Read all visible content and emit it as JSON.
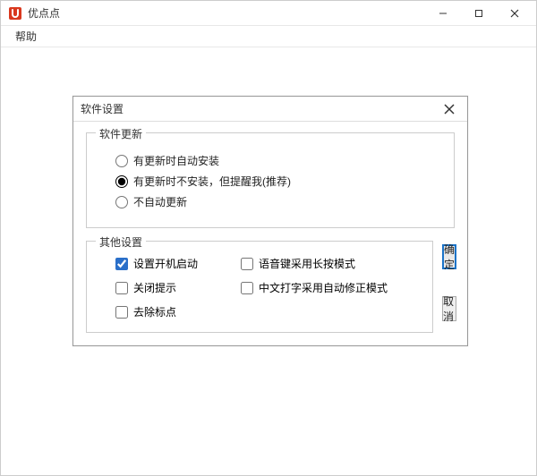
{
  "app": {
    "title": "优点点",
    "menu": {
      "help": "帮助"
    }
  },
  "dialog": {
    "title": "软件设置",
    "groups": {
      "update": {
        "legend": "软件更新",
        "options": [
          {
            "label": "有更新时自动安装",
            "selected": false
          },
          {
            "label": "有更新时不安装，但提醒我(推荐)",
            "selected": true
          },
          {
            "label": "不自动更新",
            "selected": false
          }
        ]
      },
      "other": {
        "legend": "其他设置",
        "checks": [
          {
            "label": "设置开机启动",
            "checked": true
          },
          {
            "label": "语音键采用长按模式",
            "checked": false
          },
          {
            "label": "关闭提示",
            "checked": false
          },
          {
            "label": "中文打字采用自动修正模式",
            "checked": false
          },
          {
            "label": "去除标点",
            "checked": false
          }
        ]
      }
    },
    "buttons": {
      "ok": "确定",
      "cancel": "取消"
    }
  }
}
